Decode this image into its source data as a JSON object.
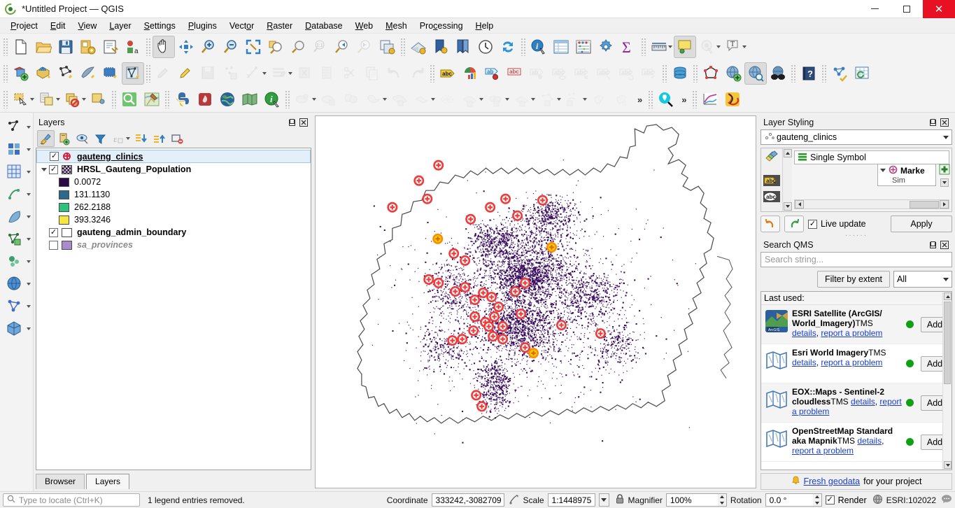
{
  "window": {
    "title": "*Untitled Project — QGIS",
    "app_icon": "qgis-logo-icon",
    "minimize": "minimize-icon",
    "maximize": "maximize-icon",
    "close": "✕"
  },
  "menubar": [
    {
      "label": "Project",
      "accel": "P"
    },
    {
      "label": "Edit",
      "accel": "E"
    },
    {
      "label": "View",
      "accel": "V"
    },
    {
      "label": "Layer",
      "accel": "L"
    },
    {
      "label": "Settings",
      "accel": "S"
    },
    {
      "label": "Plugins",
      "accel": "P"
    },
    {
      "label": "Vector",
      "accel": "o"
    },
    {
      "label": "Raster",
      "accel": "R"
    },
    {
      "label": "Database",
      "accel": "D"
    },
    {
      "label": "Web",
      "accel": "W"
    },
    {
      "label": "Mesh",
      "accel": "M"
    },
    {
      "label": "Processing",
      "accel": "c"
    },
    {
      "label": "Help",
      "accel": "H"
    }
  ],
  "toolbar_row1": [
    {
      "name": "new-project-icon",
      "state": "normal"
    },
    {
      "name": "open-project-icon",
      "state": "normal"
    },
    {
      "name": "save-project-icon",
      "state": "normal"
    },
    {
      "name": "save-project-as-icon",
      "state": "normal"
    },
    {
      "name": "project-properties-icon",
      "state": "normal"
    },
    {
      "name": "new-print-layout-icon",
      "state": "normal"
    },
    {
      "name": "pan-map-icon",
      "state": "active"
    },
    {
      "name": "pan-to-selection-icon",
      "state": "normal"
    },
    {
      "name": "zoom-in-icon",
      "state": "normal"
    },
    {
      "name": "zoom-out-icon",
      "state": "normal"
    },
    {
      "name": "zoom-full-icon",
      "state": "normal"
    },
    {
      "name": "zoom-to-selection-icon",
      "state": "normal"
    },
    {
      "name": "zoom-to-layer-icon",
      "state": "normal"
    },
    {
      "name": "zoom-native-resolution-icon",
      "state": "disabled"
    },
    {
      "name": "zoom-last-icon",
      "state": "normal"
    },
    {
      "name": "zoom-next-icon",
      "state": "disabled"
    },
    {
      "name": "new-map-view-icon",
      "state": "normal"
    },
    {
      "name": "new-3d-map-view-icon",
      "state": "normal"
    },
    {
      "name": "new-print-layout-2-icon",
      "state": "normal"
    },
    {
      "name": "layout-manager-icon",
      "state": "normal"
    },
    {
      "name": "temporal-controller-icon",
      "state": "normal"
    },
    {
      "name": "refresh-icon",
      "state": "normal"
    },
    {
      "name": "identify-features-icon",
      "state": "normal"
    },
    {
      "name": "attribute-table-icon",
      "state": "normal"
    },
    {
      "name": "statistical-summary-icon",
      "state": "normal"
    },
    {
      "name": "options-icon",
      "state": "normal"
    },
    {
      "name": "sum-field-icon",
      "state": "normal"
    },
    {
      "name": "measure-line-icon",
      "state": "normal"
    },
    {
      "name": "map-tips-icon",
      "state": "active"
    },
    {
      "name": "annotations-icon",
      "state": "disabled"
    },
    {
      "name": "text-annotation-icon",
      "state": "normal"
    }
  ],
  "toolbar_row2": [
    {
      "name": "add-vector-layer-icon",
      "state": "normal"
    },
    {
      "name": "add-raster-layer-icon",
      "state": "normal"
    },
    {
      "name": "add-delimited-text-layer-icon",
      "state": "normal"
    },
    {
      "name": "add-spatialite-layer-icon",
      "state": "normal"
    },
    {
      "name": "add-mesh-layer-icon",
      "state": "normal"
    },
    {
      "name": "new-virtual-layer-icon",
      "state": "active"
    },
    {
      "name": "current-edits-icon",
      "state": "disabled"
    },
    {
      "name": "toggle-editing-icon",
      "state": "normal"
    },
    {
      "name": "save-layer-edits-icon",
      "state": "disabled"
    },
    {
      "name": "add-feature-icon",
      "state": "disabled"
    },
    {
      "name": "vertex-tool-icon",
      "state": "disabled"
    },
    {
      "name": "modify-attributes-icon",
      "state": "disabled"
    },
    {
      "name": "delete-selected-icon",
      "state": "disabled"
    },
    {
      "name": "cut-features-icon",
      "state": "disabled"
    },
    {
      "name": "copy-features-icon",
      "state": "disabled"
    },
    {
      "name": "paste-features-icon",
      "state": "disabled"
    },
    {
      "name": "undo-icon",
      "state": "disabled"
    },
    {
      "name": "redo-icon",
      "state": "disabled"
    },
    {
      "name": "label-layer-icon",
      "state": "normal"
    },
    {
      "name": "diagram-layer-icon",
      "state": "normal"
    },
    {
      "name": "move-label-icon",
      "state": "normal"
    },
    {
      "name": "rotate-label-icon",
      "state": "normal"
    },
    {
      "name": "change-label-icon",
      "state": "disabled"
    },
    {
      "name": "show-hide-labels-icon",
      "state": "disabled"
    },
    {
      "name": "pin-labels-icon",
      "state": "disabled"
    },
    {
      "name": "highlight-pinned-labels-icon",
      "state": "disabled"
    },
    {
      "name": "rotate-label-2-icon",
      "state": "disabled"
    },
    {
      "name": "change-label-properties-icon",
      "state": "disabled"
    },
    {
      "name": "db-manager-icon",
      "state": "normal"
    },
    {
      "name": "topology-checker-icon",
      "state": "normal"
    },
    {
      "name": "metasearch-add-icon",
      "state": "normal"
    },
    {
      "name": "metasearch-search-icon",
      "state": "active"
    },
    {
      "name": "spyglass-icon",
      "state": "normal"
    },
    {
      "name": "help-contents-icon",
      "state": "normal"
    },
    {
      "name": "network-analysis-icon",
      "state": "normal"
    },
    {
      "name": "refresh-table-icon",
      "state": "normal"
    }
  ],
  "toolbar_row3": [
    {
      "name": "select-features-icon",
      "state": "normal"
    },
    {
      "name": "select-by-expression-icon",
      "state": "normal"
    },
    {
      "name": "deselect-features-icon",
      "state": "normal"
    },
    {
      "name": "select-value-icon",
      "state": "normal"
    },
    {
      "name": "qms-search-icon",
      "state": "normal"
    },
    {
      "name": "osm-place-search-icon",
      "state": "normal"
    },
    {
      "name": "python-console-icon",
      "state": "normal"
    },
    {
      "name": "plugin-manager-icon",
      "state": "normal"
    },
    {
      "name": "globe-plugin-icon",
      "state": "normal"
    },
    {
      "name": "green-map-plugin-icon",
      "state": "normal"
    },
    {
      "name": "info-plugin-icon",
      "state": "normal"
    },
    {
      "name": "geoprocessing-buffer-icon",
      "state": "disabled"
    },
    {
      "name": "geoprocessing-clip-icon",
      "state": "disabled"
    },
    {
      "name": "geoprocessing-intersect-icon",
      "state": "disabled"
    },
    {
      "name": "geoprocessing-union-icon",
      "state": "disabled"
    },
    {
      "name": "geoprocessing-dissolve-icon",
      "state": "disabled"
    },
    {
      "name": "geometry-simplify-icon",
      "state": "disabled"
    },
    {
      "name": "geometry-centroid-icon",
      "state": "disabled"
    },
    {
      "name": "geometry-convexhull-icon",
      "state": "disabled"
    },
    {
      "name": "geometry-voronoi-icon",
      "state": "disabled"
    },
    {
      "name": "geometry-delaunay-icon",
      "state": "disabled"
    },
    {
      "name": "geometry-nodes-icon",
      "state": "disabled"
    },
    {
      "name": "geometry-extract-icon",
      "state": "disabled"
    },
    {
      "name": "analysis-distance-icon",
      "state": "disabled"
    },
    {
      "name": "analysis-sum-icon",
      "state": "disabled"
    },
    {
      "name": "overflow-chevron-1",
      "state": "overflow"
    },
    {
      "name": "qms-magnifier-icon",
      "state": "normal"
    },
    {
      "name": "overflow-chevron-2",
      "state": "overflow"
    },
    {
      "name": "plot-profile-icon",
      "state": "normal"
    },
    {
      "name": "gps-track-icon",
      "state": "normal"
    }
  ],
  "sidestrip": [
    {
      "name": "vector-tools-icon"
    },
    {
      "name": "raster-tools-icon"
    },
    {
      "name": "grid-tools-icon"
    },
    {
      "name": "interpolation-icon"
    },
    {
      "name": "feather-tools-icon"
    },
    {
      "name": "vector-overlay-icon"
    },
    {
      "name": "cluster-tools-icon"
    },
    {
      "name": "globe-tools-icon"
    },
    {
      "name": "network-tools-icon"
    },
    {
      "name": "cube-tools-icon"
    }
  ],
  "layers_panel": {
    "title": "Layers",
    "float_btn": "undock-icon",
    "close_btn": "close-icon",
    "toolbar": [
      {
        "name": "open-layer-styling-panel-icon",
        "state": "on"
      },
      {
        "name": "add-group-icon",
        "state": "normal"
      },
      {
        "name": "manage-map-themes-icon",
        "state": "normal"
      },
      {
        "name": "filter-legend-icon",
        "state": "normal"
      },
      {
        "name": "filter-legend-by-expression-icon",
        "state": "disabled"
      },
      {
        "name": "expand-all-icon",
        "state": "normal"
      },
      {
        "name": "collapse-all-icon",
        "state": "normal"
      },
      {
        "name": "remove-layer-icon",
        "state": "normal"
      }
    ],
    "items": [
      {
        "type": "layer",
        "label": "gauteng_clinics",
        "checked": true,
        "selected": true,
        "icon": "point-layer-icon",
        "style": "link"
      },
      {
        "type": "layer",
        "label": "HRSL_Gauteng_Population",
        "checked": true,
        "selected": false,
        "icon": "raster-layer-icon",
        "expandable": true,
        "style": "bold"
      },
      {
        "type": "legend",
        "label": "0.0072",
        "color": "#2c0b47"
      },
      {
        "type": "legend",
        "label": "131.1130",
        "color": "#2a6a8f"
      },
      {
        "type": "legend",
        "label": "262.2188",
        "color": "#2ec27e"
      },
      {
        "type": "legend",
        "label": "393.3246",
        "color": "#f5e642"
      },
      {
        "type": "layer",
        "label": "gauteng_admin_boundary",
        "checked": true,
        "selected": false,
        "color": "#ffffff",
        "style": "bold"
      },
      {
        "type": "layer",
        "label": "sa_provinces",
        "checked": false,
        "selected": false,
        "color": "#a98cc9",
        "style": "italic"
      }
    ],
    "tabs": [
      {
        "label": "Browser",
        "active": false
      },
      {
        "label": "Layers",
        "active": true
      }
    ]
  },
  "layer_styling": {
    "title": "Layer Styling",
    "float_btn": "undock-icon",
    "close_btn": "close-icon",
    "layer_combo": "gauteng_clinics",
    "renderer": "Single Symbol",
    "marker_node": "Marke",
    "marker_sub": "Sim",
    "undo_btn": "undo-icon",
    "redo_btn": "redo-icon",
    "live_update_label": "Live update",
    "live_update_checked": true,
    "apply_label": "Apply"
  },
  "search_qms": {
    "title": "Search QMS",
    "float_btn": "undock-icon",
    "close_btn": "close-icon",
    "search_placeholder": "Search string...",
    "search_value": "",
    "filter_by_extent_label": "Filter by extent",
    "type_filter_value": "All",
    "last_used_label": "Last used:",
    "results": [
      {
        "name": "ESRI Satellite (ArcGIS/ World_Imagery)",
        "type": "TMS",
        "details_label": "details",
        "report_label": "report a problem",
        "status_color": "#0fa014",
        "add_label": "Add",
        "thumb": "esri-satellite-thumb-icon"
      },
      {
        "name": "Esri World Imagery",
        "type": "TMS",
        "details_label": "details",
        "report_label": "report a problem",
        "status_color": "#0fa014",
        "add_label": "Add",
        "thumb": "map-thumb-icon"
      },
      {
        "name": "EOX::Maps - Sentinel-2 cloudless",
        "type": "TMS",
        "details_label": "details",
        "report_label": "report a problem",
        "status_color": "#0fa014",
        "add_label": "Add",
        "thumb": "map-thumb-icon"
      },
      {
        "name": "OpenStreetMap Standard aka Mapnik",
        "type": "TMS",
        "details_label": "details",
        "report_label": "report a problem",
        "status_color": "#0fa014",
        "add_label": "Add",
        "thumb": "map-thumb-icon"
      }
    ],
    "footer_icon": "bell-icon",
    "footer_link": "Fresh geodata",
    "footer_text": "for your project"
  },
  "statusbar": {
    "locate_placeholder": "Type to locate (Ctrl+K)",
    "message": "1 legend entries removed.",
    "coordinate_label": "Coordinate",
    "coordinate_value": "333242,-3082709",
    "toggle_extents_icon": "toggle-extents-icon",
    "scale_label": "Scale",
    "scale_value": "1:1448975",
    "lock_icon": "lock-scale-icon",
    "magnifier_label": "Magnifier",
    "magnifier_value": "100%",
    "rotation_label": "Rotation",
    "rotation_value": "0.0 °",
    "render_label": "Render",
    "render_checked": true,
    "crs_icon": "crs-globe-icon",
    "crs_value": "ESRI:102022",
    "messages_icon": "messages-icon"
  },
  "map": {
    "name": "map-canvas",
    "boundary_color": "#555555",
    "population_dot_color": "#3b0d5e",
    "clinic_marker_stroke": "#ef3b3b",
    "clinic_marker_fill": "#ffffff",
    "clinic_marker_selected_fill": "#ffd400"
  }
}
